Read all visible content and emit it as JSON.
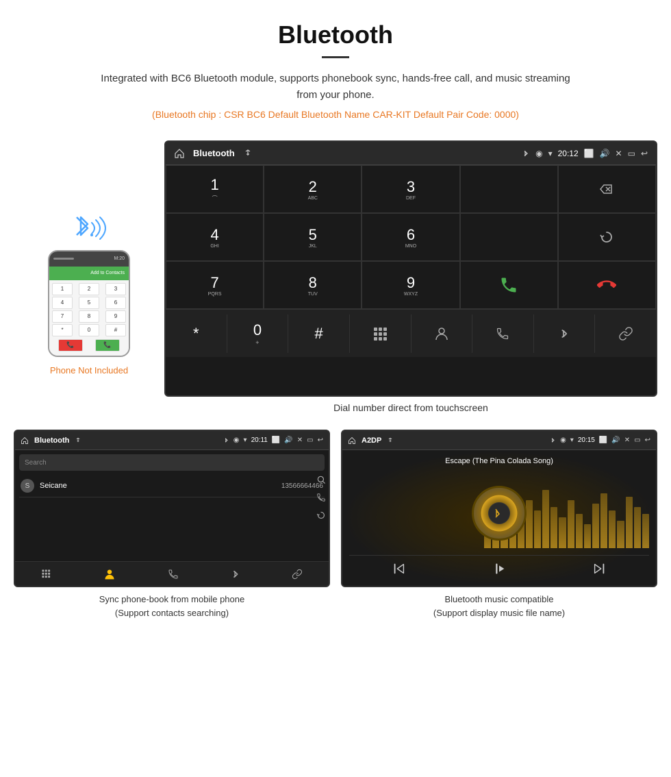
{
  "header": {
    "title": "Bluetooth",
    "description": "Integrated with BC6 Bluetooth module, supports phonebook sync, hands-free call, and music streaming from your phone.",
    "specs": "(Bluetooth chip : CSR BC6    Default Bluetooth Name CAR-KIT    Default Pair Code: 0000)"
  },
  "main_screen": {
    "title": "Bluetooth",
    "time": "20:12",
    "keys": [
      {
        "num": "1",
        "sub": ""
      },
      {
        "num": "2",
        "sub": "ABC"
      },
      {
        "num": "3",
        "sub": "DEF"
      },
      {
        "num": "4",
        "sub": "GHI"
      },
      {
        "num": "5",
        "sub": "JKL"
      },
      {
        "num": "6",
        "sub": "MNO"
      },
      {
        "num": "7",
        "sub": "PQRS"
      },
      {
        "num": "8",
        "sub": "TUV"
      },
      {
        "num": "9",
        "sub": "WXYZ"
      },
      {
        "num": "*",
        "sub": ""
      },
      {
        "num": "0",
        "sub": "+"
      },
      {
        "num": "#",
        "sub": ""
      }
    ],
    "caption": "Dial number direct from touchscreen"
  },
  "phone_label": "Phone Not Included",
  "phonebook_screen": {
    "title": "Bluetooth",
    "time": "20:11",
    "search_placeholder": "Search",
    "contacts": [
      {
        "initial": "S",
        "name": "Seicane",
        "number": "13566664466"
      }
    ],
    "caption_line1": "Sync phone-book from mobile phone",
    "caption_line2": "(Support contacts searching)"
  },
  "music_screen": {
    "title": "A2DP",
    "time": "20:15",
    "song_title": "Escape (The Pina Colada Song)",
    "caption_line1": "Bluetooth music compatible",
    "caption_line2": "(Support display music file name)"
  },
  "bottom_bar_icons": {
    "grid": "⊞",
    "person": "👤",
    "phone": "📞",
    "bluetooth": "✱",
    "link": "🔗"
  },
  "eq_bar_heights": [
    30,
    55,
    80,
    65,
    40,
    70,
    55,
    85,
    60,
    45,
    70,
    50,
    35,
    65,
    80,
    55,
    40,
    75,
    60,
    50
  ]
}
